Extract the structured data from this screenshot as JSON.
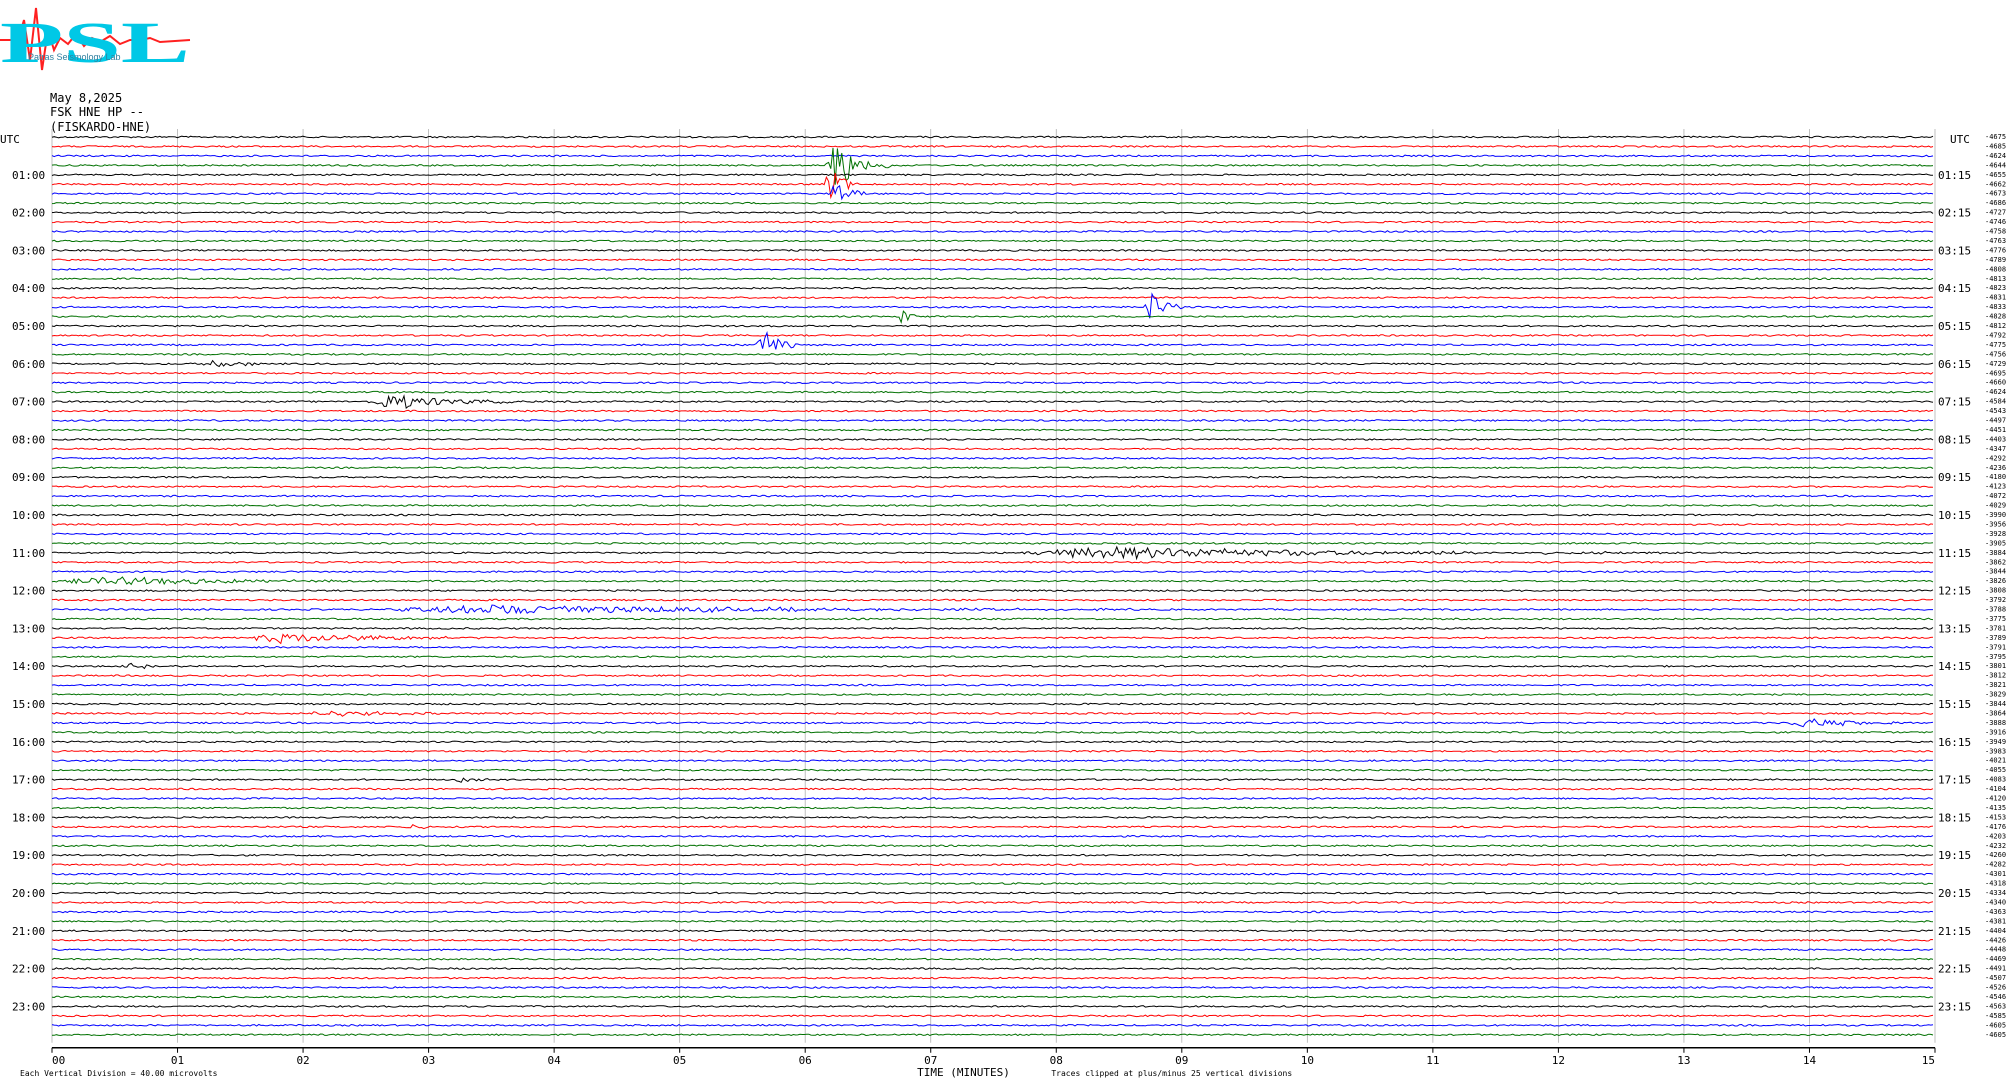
{
  "header": {
    "date": "May 8,2025",
    "channel": "FSK HNE HP --",
    "station": "(FISKARDO-HNE)"
  },
  "logo": {
    "text": "PSL",
    "small_text": "Patras Seismology Lab"
  },
  "colors": {
    "trace_cycle": [
      "#000000",
      "#ff0000",
      "#0000ff",
      "#007000"
    ],
    "grid": "#b0b0b0",
    "logo_cyan": "#00c8e6",
    "logo_red": "#ff2020"
  },
  "chart_data": {
    "type": "helicorder",
    "left_axis_title": "UTC",
    "right_axis_title": "UTC",
    "left_hour_labels": [
      "01:00",
      "02:00",
      "03:00",
      "04:00",
      "05:00",
      "06:00",
      "07:00",
      "08:00",
      "09:00",
      "10:00",
      "11:00",
      "12:00",
      "13:00",
      "14:00",
      "15:00",
      "16:00",
      "17:00",
      "18:00",
      "19:00",
      "20:00",
      "21:00",
      "22:00",
      "23:00"
    ],
    "right_time_labels": [
      "01:15",
      "02:15",
      "03:15",
      "04:15",
      "05:15",
      "06:15",
      "07:15",
      "08:15",
      "09:15",
      "10:15",
      "11:15",
      "12:15",
      "13:15",
      "14:15",
      "15:15",
      "16:15",
      "17:15",
      "18:15",
      "19:15",
      "20:15",
      "21:15",
      "22:15",
      "23:15"
    ],
    "x_ticks": [
      "00",
      "01",
      "02",
      "03",
      "04",
      "05",
      "06",
      "07",
      "08",
      "09",
      "10",
      "11",
      "12",
      "13",
      "14",
      "15"
    ],
    "xlabel": "TIME (MINUTES)",
    "xlim": [
      0,
      15
    ],
    "rows_per_hour": 4,
    "row_count": 96,
    "right_values": [
      "-4675",
      "-4685",
      "-4624",
      "-4644",
      "-4655",
      "-4662",
      "-4673",
      "-4686",
      "-4727",
      "-4746",
      "-4758",
      "-4763",
      "-4776",
      "-4789",
      "-4808",
      "-4813",
      "-4823",
      "-4831",
      "-4833",
      "-4828",
      "-4812",
      "-4792",
      "-4775",
      "-4756",
      "-4729",
      "-4695",
      "-4660",
      "-4624",
      "-4584",
      "-4543",
      "-4497",
      "-4451",
      "-4403",
      "-4347",
      "-4292",
      "-4236",
      "-4180",
      "-4123",
      "-4072",
      "-4029",
      "-3990",
      "-3956",
      "-3928",
      "-3905",
      "-3884",
      "-3862",
      "-3844",
      "-3826",
      "-3808",
      "-3792",
      "-3788",
      "-3775",
      "-3781",
      "-3789",
      "-3791",
      "-3795",
      "-3801",
      "-3812",
      "-3821",
      "-3829",
      "-3844",
      "-3864",
      "-3888",
      "-3916",
      "-3949",
      "-3983",
      "-4021",
      "-4055",
      "-4083",
      "-4104",
      "-4120",
      "-4135",
      "-4153",
      "-4176",
      "-4203",
      "-4232",
      "-4260",
      "-4282",
      "-4301",
      "-4318",
      "-4334",
      "-4340",
      "-4363",
      "-4381",
      "-4404",
      "-4426",
      "-4448",
      "-4469",
      "-4491",
      "-4507",
      "-4526",
      "-4546",
      "-4563",
      "-4585",
      "-4605",
      "-4605"
    ],
    "scale_note": "Each Vertical Division =   40.00 microvolts",
    "clip_note": "Traces clipped at plus/minus 25 vertical divisions",
    "events": [
      {
        "row": 3,
        "minute": 6.15,
        "duration": 0.55,
        "amplitude": 28,
        "color": "#007000"
      },
      {
        "row": 5,
        "minute": 6.15,
        "duration": 0.3,
        "amplitude": 20,
        "color": "#007000"
      },
      {
        "row": 6,
        "minute": 6.2,
        "duration": 0.3,
        "amplitude": 16,
        "color": "#007000"
      },
      {
        "row": 18,
        "minute": 8.7,
        "duration": 0.35,
        "amplitude": 16,
        "color": "#ff0000"
      },
      {
        "row": 19,
        "minute": 6.75,
        "duration": 0.15,
        "amplitude": 10,
        "color": "#007000"
      },
      {
        "row": 22,
        "minute": 5.6,
        "duration": 0.45,
        "amplitude": 14,
        "color": "#0000ff"
      },
      {
        "row": 24,
        "minute": 1.15,
        "duration": 0.9,
        "amplitude": 3,
        "color": "#ff0000"
      },
      {
        "row": 28,
        "minute": 2.5,
        "duration": 1.3,
        "amplitude": 8,
        "color": "#000000"
      },
      {
        "row": 44,
        "minute": 7.6,
        "duration": 5.3,
        "amplitude": 6,
        "color": "#ff0000"
      },
      {
        "row": 47,
        "minute": 0.0,
        "duration": 3.2,
        "amplitude": 4,
        "color": "#007000"
      },
      {
        "row": 50,
        "minute": 2.6,
        "duration": 6.2,
        "amplitude": 5,
        "color": "#0000ff"
      },
      {
        "row": 53,
        "minute": 1.5,
        "duration": 2.2,
        "amplitude": 5,
        "color": "#ff0000"
      },
      {
        "row": 56,
        "minute": 0.5,
        "duration": 0.7,
        "amplitude": 4,
        "color": "#000000"
      },
      {
        "row": 62,
        "minute": 13.8,
        "duration": 1.1,
        "amplitude": 5,
        "color": "#0000ff"
      },
      {
        "row": 61,
        "minute": 2.0,
        "duration": 1.5,
        "amplitude": 3,
        "color": "#0000ff"
      },
      {
        "row": 73,
        "minute": 2.8,
        "duration": 0.3,
        "amplitude": 4,
        "color": "#000000"
      },
      {
        "row": 68,
        "minute": 3.2,
        "duration": 0.3,
        "amplitude": 3,
        "color": "#000000"
      }
    ]
  }
}
